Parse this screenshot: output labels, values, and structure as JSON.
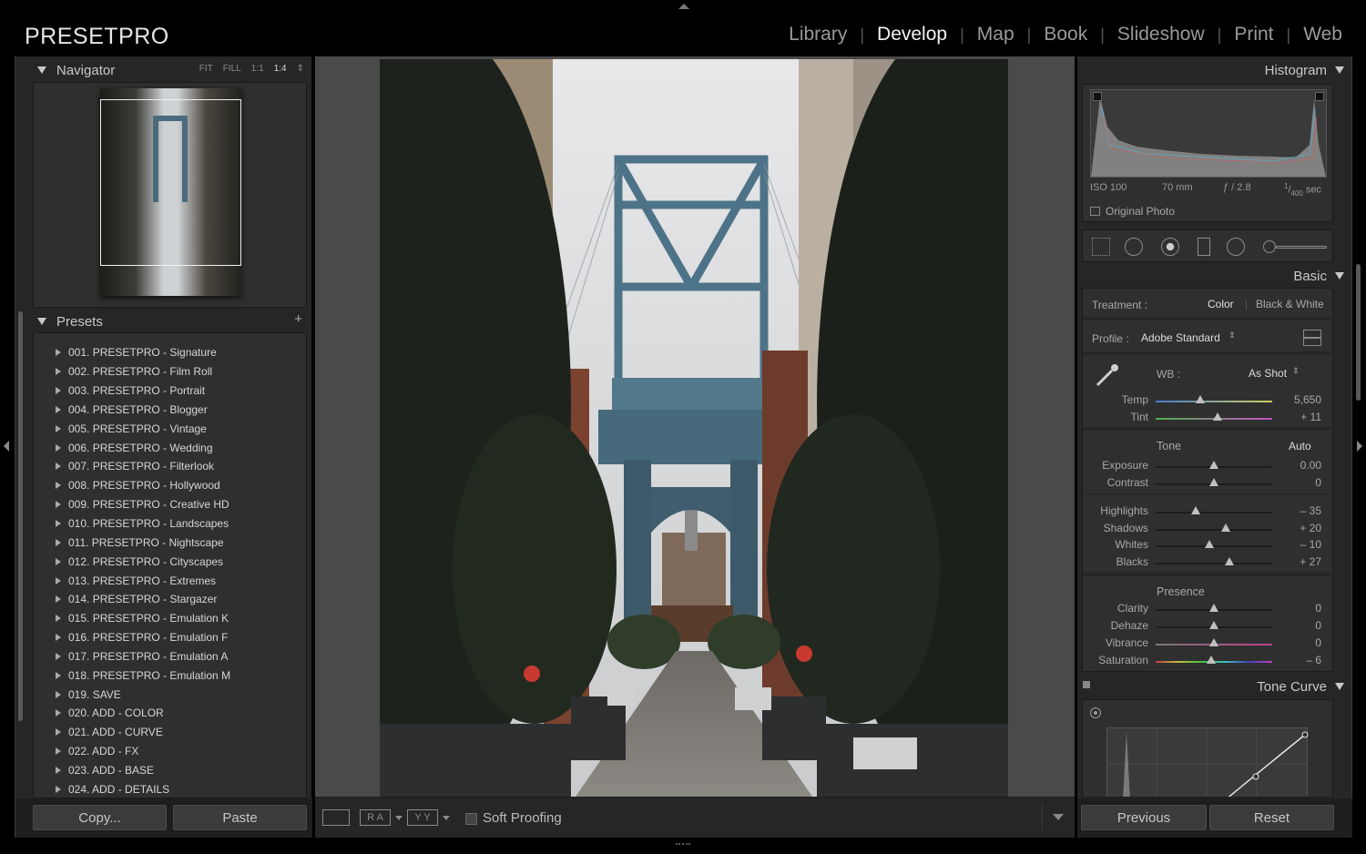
{
  "app": {
    "logo": "PRESETPRO",
    "modules": [
      {
        "label": "Library"
      },
      {
        "label": "Develop",
        "active": true
      },
      {
        "label": "Map"
      },
      {
        "label": "Book"
      },
      {
        "label": "Slideshow"
      },
      {
        "label": "Print"
      },
      {
        "label": "Web"
      }
    ]
  },
  "navigator": {
    "title": "Navigator",
    "zoom": {
      "fit": "FIT",
      "fill": "FILL",
      "one": "1:1",
      "quarter": "1:4"
    }
  },
  "presets": {
    "title": "Presets",
    "items": [
      "001. PRESETPRO - Signature",
      "002. PRESETPRO - Film Roll",
      "003. PRESETPRO - Portrait",
      "004. PRESETPRO - Blogger",
      "005. PRESETPRO - Vintage",
      "006. PRESETPRO - Wedding",
      "007. PRESETPRO - Filterlook",
      "008. PRESETPRO - Hollywood",
      "009. PRESETPRO - Creative HD",
      "010. PRESETPRO - Landscapes",
      "011. PRESETPRO - Nightscape",
      "012. PRESETPRO - Cityscapes",
      "013. PRESETPRO - Extremes",
      "014. PRESETPRO - Stargazer",
      "015. PRESETPRO - Emulation K",
      "016. PRESETPRO - Emulation F",
      "017. PRESETPRO - Emulation A",
      "018. PRESETPRO - Emulation M",
      "019. SAVE",
      "020. ADD - COLOR",
      "021. ADD - CURVE",
      "022. ADD - FX",
      "023. ADD - BASE",
      "024. ADD - DETAILS"
    ]
  },
  "left_buttons": {
    "copy": "Copy...",
    "paste": "Paste"
  },
  "toolbar": {
    "soft_proofing": "Soft Proofing",
    "ra": "R A",
    "yy": "Y Y"
  },
  "histogram": {
    "title": "Histogram",
    "iso": "ISO 100",
    "focal": "70 mm",
    "aperture": "ƒ / 2.8",
    "shutter_num": "1",
    "shutter_den": "400",
    "shutter_unit": "sec",
    "original_photo": "Original Photo"
  },
  "basic": {
    "title": "Basic",
    "treatment_label": "Treatment :",
    "treatment_color": "Color",
    "treatment_bw": "Black & White",
    "profile_label": "Profile :",
    "profile_value": "Adobe Standard",
    "wb_label": "WB :",
    "wb_value": "As Shot",
    "tone_label": "Tone",
    "auto_label": "Auto",
    "presence_label": "Presence",
    "wb_sliders": [
      {
        "label": "Temp",
        "value": "5,650",
        "pos": 0.38
      },
      {
        "label": "Tint",
        "value": "+ 11",
        "pos": 0.53
      }
    ],
    "tone_sliders": [
      {
        "label": "Exposure",
        "value": "0.00",
        "pos": 0.5
      },
      {
        "label": "Contrast",
        "value": "0",
        "pos": 0.5
      }
    ],
    "tone2_sliders": [
      {
        "label": "Highlights",
        "value": "– 35",
        "pos": 0.34
      },
      {
        "label": "Shadows",
        "value": "+ 20",
        "pos": 0.6
      },
      {
        "label": "Whites",
        "value": "– 10",
        "pos": 0.46
      },
      {
        "label": "Blacks",
        "value": "+ 27",
        "pos": 0.63
      }
    ],
    "presence_sliders": [
      {
        "label": "Clarity",
        "value": "0",
        "pos": 0.5
      },
      {
        "label": "Dehaze",
        "value": "0",
        "pos": 0.5
      },
      {
        "label": "Vibrance",
        "value": "0",
        "pos": 0.5
      },
      {
        "label": "Saturation",
        "value": "– 6",
        "pos": 0.48
      }
    ]
  },
  "tone_curve": {
    "title": "Tone Curve"
  },
  "right_buttons": {
    "previous": "Previous",
    "reset": "Reset"
  }
}
